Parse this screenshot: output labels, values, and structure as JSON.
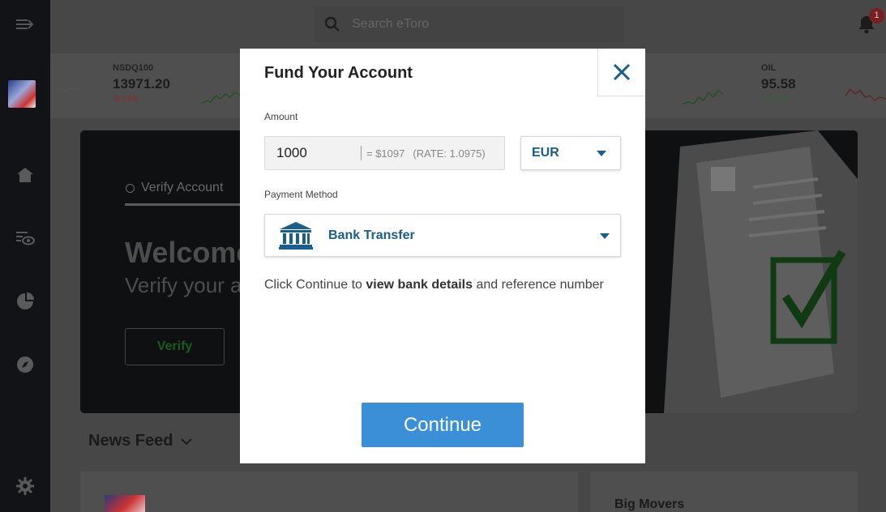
{
  "search": {
    "placeholder": "Search eToro"
  },
  "notifications": {
    "count": "1"
  },
  "tickers": [
    {
      "name": "NSDQ100",
      "price": "13971.20",
      "change": "-0.19%",
      "change_color": "#8a2a2a"
    },
    {
      "name": "OIL",
      "price": "95.58",
      "change": "+1.70%",
      "change_color": "#2e6b2e"
    }
  ],
  "hero": {
    "tab_label": "Verify Account",
    "heading": "Welcome",
    "subheading": "Verify your a",
    "verify_button": "Verify"
  },
  "news": {
    "title": "News Feed"
  },
  "movers": {
    "title": "Big Movers"
  },
  "modal": {
    "title": "Fund Your Account",
    "amount_label": "Amount",
    "amount_value": "1000",
    "conversion": "= $1097",
    "rate": "(RATE: 1.0975)",
    "currency": "EUR",
    "payment_label": "Payment Method",
    "payment_method": "Bank Transfer",
    "info_prefix": "Click Continue to ",
    "info_bold": "view bank details",
    "info_suffix": " and reference number",
    "continue_label": "Continue"
  },
  "colors": {
    "accent": "#3a8fd6",
    "brand_text": "#1a5e8c"
  }
}
